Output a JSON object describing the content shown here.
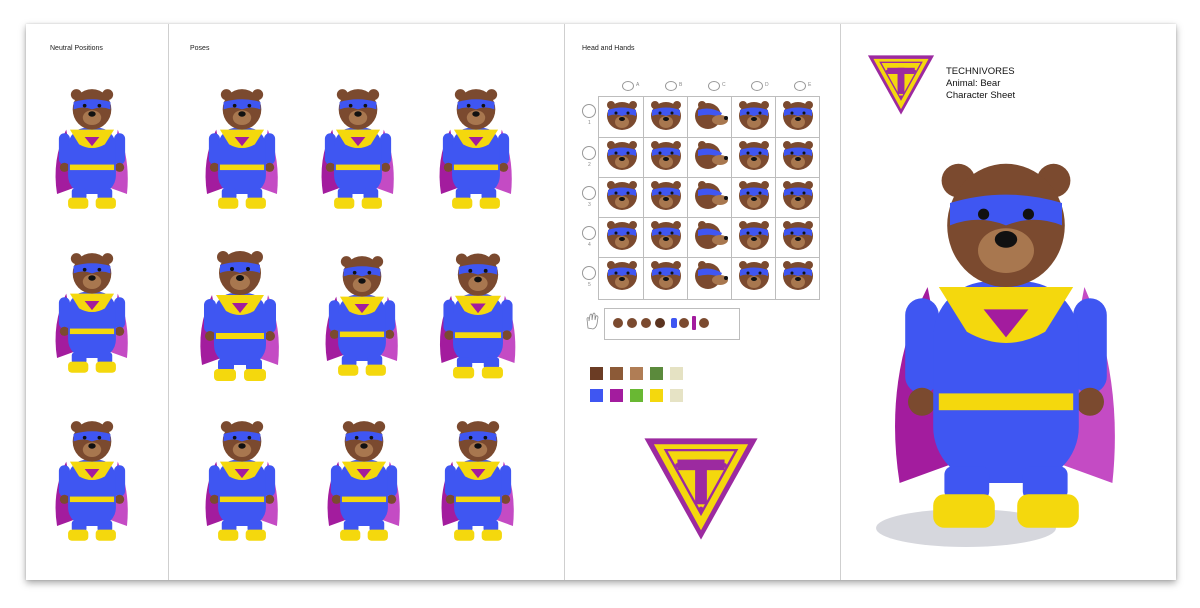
{
  "labels": {
    "neutral": "Neutral Positions",
    "poses": "Poses",
    "head_hands": "Head and Hands"
  },
  "brand": {
    "name": "TECHNIVORES",
    "animal": "Animal: Bear",
    "sheet": "Character Sheet"
  },
  "grid": {
    "columns": [
      "A",
      "B",
      "C",
      "D",
      "E"
    ],
    "rows": [
      "1",
      "2",
      "3",
      "4",
      "5"
    ]
  },
  "colors": {
    "fur": "#7b4a2f",
    "fur_dark": "#5b3420",
    "muzzle": "#a8774f",
    "suit": "#3f56f2",
    "yellow": "#f4d80d",
    "cape": "#a31c9e",
    "cape_light": "#c44bc4",
    "logo_border": "#9c2aa0"
  },
  "palette": [
    "#6b3c24",
    "#8c5a37",
    "#b07d55",
    "#5b8a3c",
    "#e5e2c3",
    "#3f56f2",
    "#a31c9e",
    "#69b833",
    "#f4d80d",
    "#e6e3c5"
  ],
  "icons": {
    "logo": "triangle-t-logo",
    "hand": "hand-outline-icon"
  }
}
